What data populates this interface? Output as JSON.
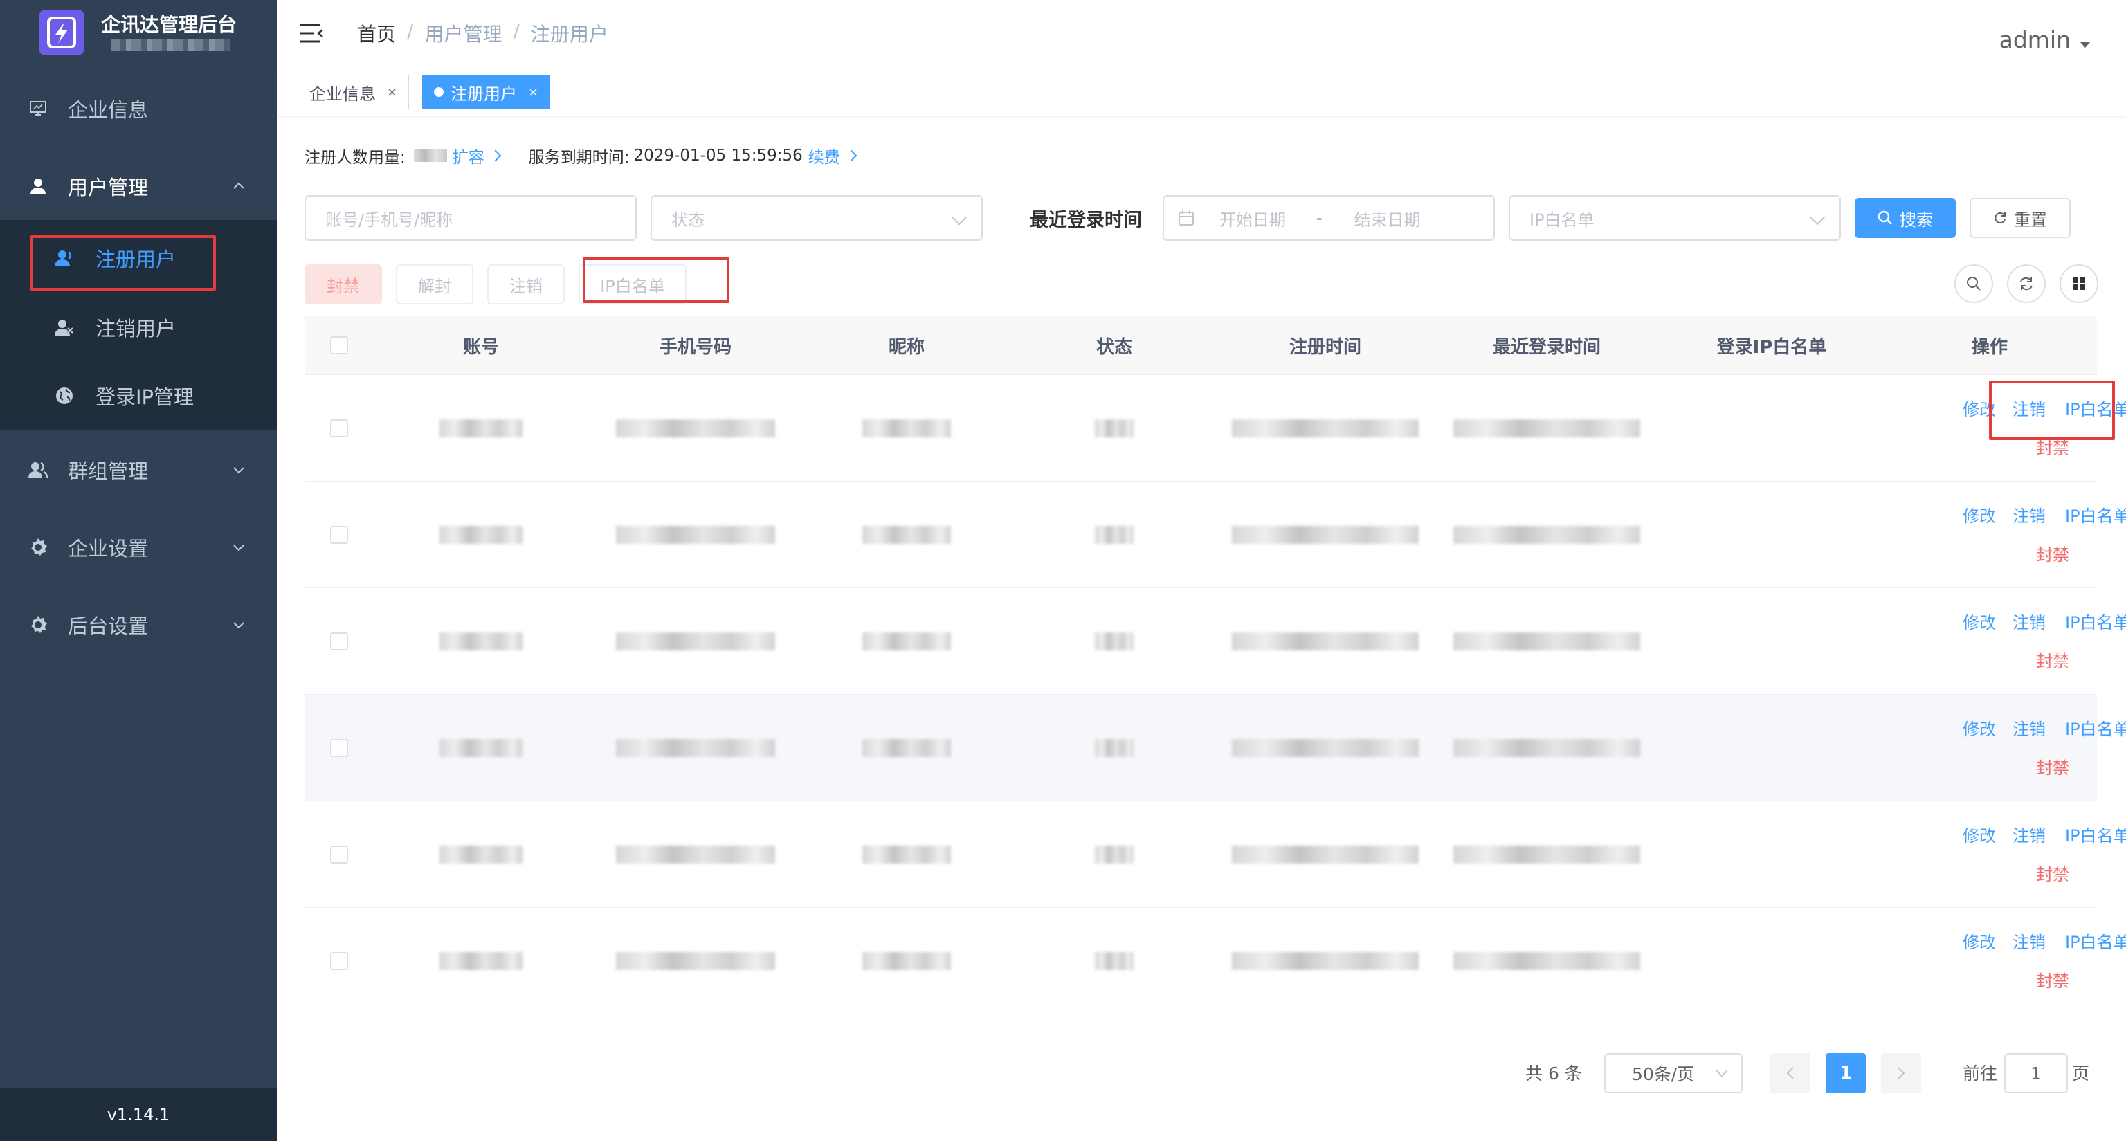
{
  "sidebar": {
    "brand_title": "企讯达管理后台",
    "menu": [
      {
        "label": "企业信息",
        "icon": "monitor-icon"
      },
      {
        "label": "用户管理",
        "icon": "user-icon",
        "expanded": true
      },
      {
        "label": "群组管理",
        "icon": "group-icon"
      },
      {
        "label": "企业设置",
        "icon": "gear-icon"
      },
      {
        "label": "后台设置",
        "icon": "gear-icon"
      }
    ],
    "submenu": [
      {
        "label": "注册用户",
        "icon": "user-check-icon",
        "active": true
      },
      {
        "label": "注销用户",
        "icon": "user-remove-icon"
      },
      {
        "label": "登录IP管理",
        "icon": "globe-icon"
      }
    ],
    "version": "v1.14.1"
  },
  "header": {
    "breadcrumb": [
      "首页",
      "用户管理",
      "注册用户"
    ],
    "separator": "/",
    "user": "admin"
  },
  "tags": [
    {
      "label": "企业信息",
      "close": "×"
    },
    {
      "label": "注册用户",
      "close": "×",
      "active": true
    }
  ],
  "info": {
    "registered_label": "注册人数用量:",
    "expand_link": "扩容",
    "expire_label": "服务到期时间:",
    "expire_value": "2029-01-05 15:59:56",
    "renew_link": "续费"
  },
  "filters": {
    "account_placeholder": "账号/手机号/昵称",
    "status_placeholder": "状态",
    "login_time_label": "最近登录时间",
    "start_placeholder": "开始日期",
    "range_sep": "-",
    "end_placeholder": "结束日期",
    "ip_placeholder": "IP白名单",
    "search_label": "搜索",
    "reset_label": "重置"
  },
  "actions": {
    "ban": "封禁",
    "unban": "解封",
    "cancel": "注销",
    "ip_whitelist": "IP白名单"
  },
  "table": {
    "columns": [
      "账号",
      "手机号码",
      "昵称",
      "状态",
      "注册时间",
      "最近登录时间",
      "登录IP白名单",
      "操作"
    ],
    "row_count": 6,
    "row_ops": {
      "edit": "修改",
      "cancel": "注销",
      "ip": "IP白名单",
      "ban": "封禁"
    }
  },
  "pagination": {
    "total": "共 6 条",
    "page_size": "50条/页",
    "current_page": "1",
    "goto_label": "前往",
    "goto_value": "1",
    "page_suffix": "页"
  },
  "colors": {
    "primary": "#409eff",
    "danger": "#f56c6c",
    "sidebar_bg": "#304156",
    "highlight_box": "#e43b3b"
  }
}
